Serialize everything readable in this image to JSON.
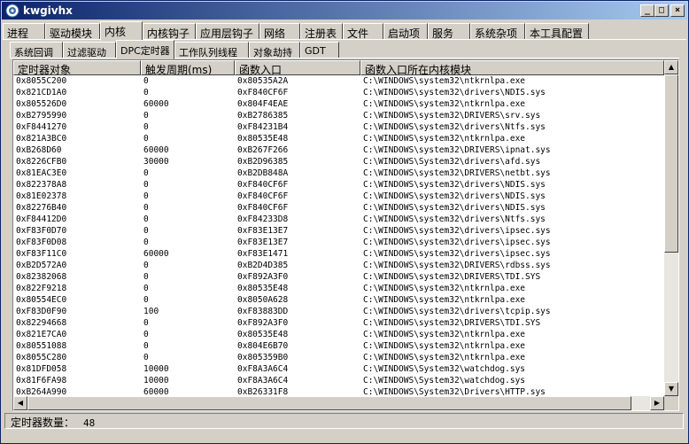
{
  "window": {
    "title": "kwgivhx"
  },
  "title_buttons": {
    "minimize": "_",
    "maximize": "□",
    "close": "×"
  },
  "main_tabs": [
    "进程",
    "驱动模块",
    "内核",
    "内核钩子",
    "应用层钩子",
    "网络",
    "注册表",
    "文件",
    "启动项",
    "服务",
    "系统杂项",
    "本工具配置"
  ],
  "main_active": 2,
  "sub_tabs": [
    "系统回调",
    "过滤驱动",
    "DPC定时器",
    "工作队列线程",
    "对象劫持",
    "GDT"
  ],
  "sub_active": 2,
  "columns": [
    "定时器对象",
    "触发周期(ms)",
    "函数入口",
    "函数入口所在内核模块"
  ],
  "rows": [
    [
      "0x8055C200",
      "0",
      "0x80535A2A",
      "C:\\WINDOWS\\system32\\ntkrnlpa.exe"
    ],
    [
      "0x821CD1A0",
      "0",
      "0xF840CF6F",
      "C:\\WINDOWS\\system32\\drivers\\NDIS.sys"
    ],
    [
      "0x805526D0",
      "60000",
      "0x804F4EAE",
      "C:\\WINDOWS\\system32\\ntkrnlpa.exe"
    ],
    [
      "0xB2795990",
      "0",
      "0xB2786385",
      "C:\\WINDOWS\\system32\\DRIVERS\\srv.sys"
    ],
    [
      "0xF8441270",
      "0",
      "0xF84231B4",
      "C:\\WINDOWS\\system32\\drivers\\Ntfs.sys"
    ],
    [
      "0x821A3BC0",
      "0",
      "0x80535E48",
      "C:\\WINDOWS\\system32\\ntkrnlpa.exe"
    ],
    [
      "0xB268D60",
      "60000",
      "0xB267F266",
      "C:\\WINDOWS\\system32\\DRIVERS\\ipnat.sys"
    ],
    [
      "0x8226CFB0",
      "30000",
      "0xB2D96385",
      "C:\\WINDOWS\\System32\\drivers\\afd.sys"
    ],
    [
      "0x81EAC3E0",
      "0",
      "0xB2DB848A",
      "C:\\WINDOWS\\system32\\DRIVERS\\netbt.sys"
    ],
    [
      "0x822378A8",
      "0",
      "0xF840CF6F",
      "C:\\WINDOWS\\system32\\drivers\\NDIS.sys"
    ],
    [
      "0x81E02378",
      "0",
      "0xF840CF6F",
      "C:\\WINDOWS\\system32\\drivers\\NDIS.sys"
    ],
    [
      "0x82276B40",
      "0",
      "0xF840CF6F",
      "C:\\WINDOWS\\system32\\drivers\\NDIS.sys"
    ],
    [
      "0xF84412D0",
      "0",
      "0xF84233D8",
      "C:\\WINDOWS\\system32\\drivers\\Ntfs.sys"
    ],
    [
      "0xF83F0D70",
      "0",
      "0xF83E13E7",
      "C:\\WINDOWS\\system32\\drivers\\ipsec.sys"
    ],
    [
      "0xF83F0D08",
      "0",
      "0xF83E13E7",
      "C:\\WINDOWS\\system32\\drivers\\ipsec.sys"
    ],
    [
      "0xF83F11C0",
      "60000",
      "0xF83E1471",
      "C:\\WINDOWS\\system32\\drivers\\ipsec.sys"
    ],
    [
      "0xB2D572A0",
      "0",
      "0xB2D4D385",
      "C:\\WINDOWS\\system32\\DRIVERS\\rdbss.sys"
    ],
    [
      "0x82382068",
      "0",
      "0xF892A3F0",
      "C:\\WINDOWS\\system32\\DRIVERS\\TDI.SYS"
    ],
    [
      "0x822F9218",
      "0",
      "0x80535E48",
      "C:\\WINDOWS\\system32\\ntkrnlpa.exe"
    ],
    [
      "0x80554EC0",
      "0",
      "0x8050A628",
      "C:\\WINDOWS\\system32\\ntkrnlpa.exe"
    ],
    [
      "0xF83D0F90",
      "100",
      "0xF83883DD",
      "C:\\WINDOWS\\system32\\drivers\\tcpip.sys"
    ],
    [
      "0x82294668",
      "0",
      "0xF892A3F0",
      "C:\\WINDOWS\\system32\\DRIVERS\\TDI.SYS"
    ],
    [
      "0x821E7CA0",
      "0",
      "0x80535E48",
      "C:\\WINDOWS\\system32\\ntkrnlpa.exe"
    ],
    [
      "0x80551088",
      "0",
      "0x804E6B70",
      "C:\\WINDOWS\\system32\\ntkrnlpa.exe"
    ],
    [
      "0x8055C280",
      "0",
      "0x805359B0",
      "C:\\WINDOWS\\system32\\ntkrnlpa.exe"
    ],
    [
      "0x81DFD058",
      "10000",
      "0xF8A3A6C4",
      "C:\\WINDOWS\\System32\\watchdog.sys"
    ],
    [
      "0x81F6FA98",
      "10000",
      "0xF8A3A6C4",
      "C:\\WINDOWS\\System32\\watchdog.sys"
    ],
    [
      "0xB264A990",
      "60000",
      "0xB26331F8",
      "C:\\WINDOWS\\System32\\Drivers\\HTTP.sys"
    ]
  ],
  "status": {
    "label": "定时器数量：",
    "count": "48"
  },
  "scroll": {
    "vertical_fraction": 0.58,
    "horizontal_fraction": 0.97
  }
}
